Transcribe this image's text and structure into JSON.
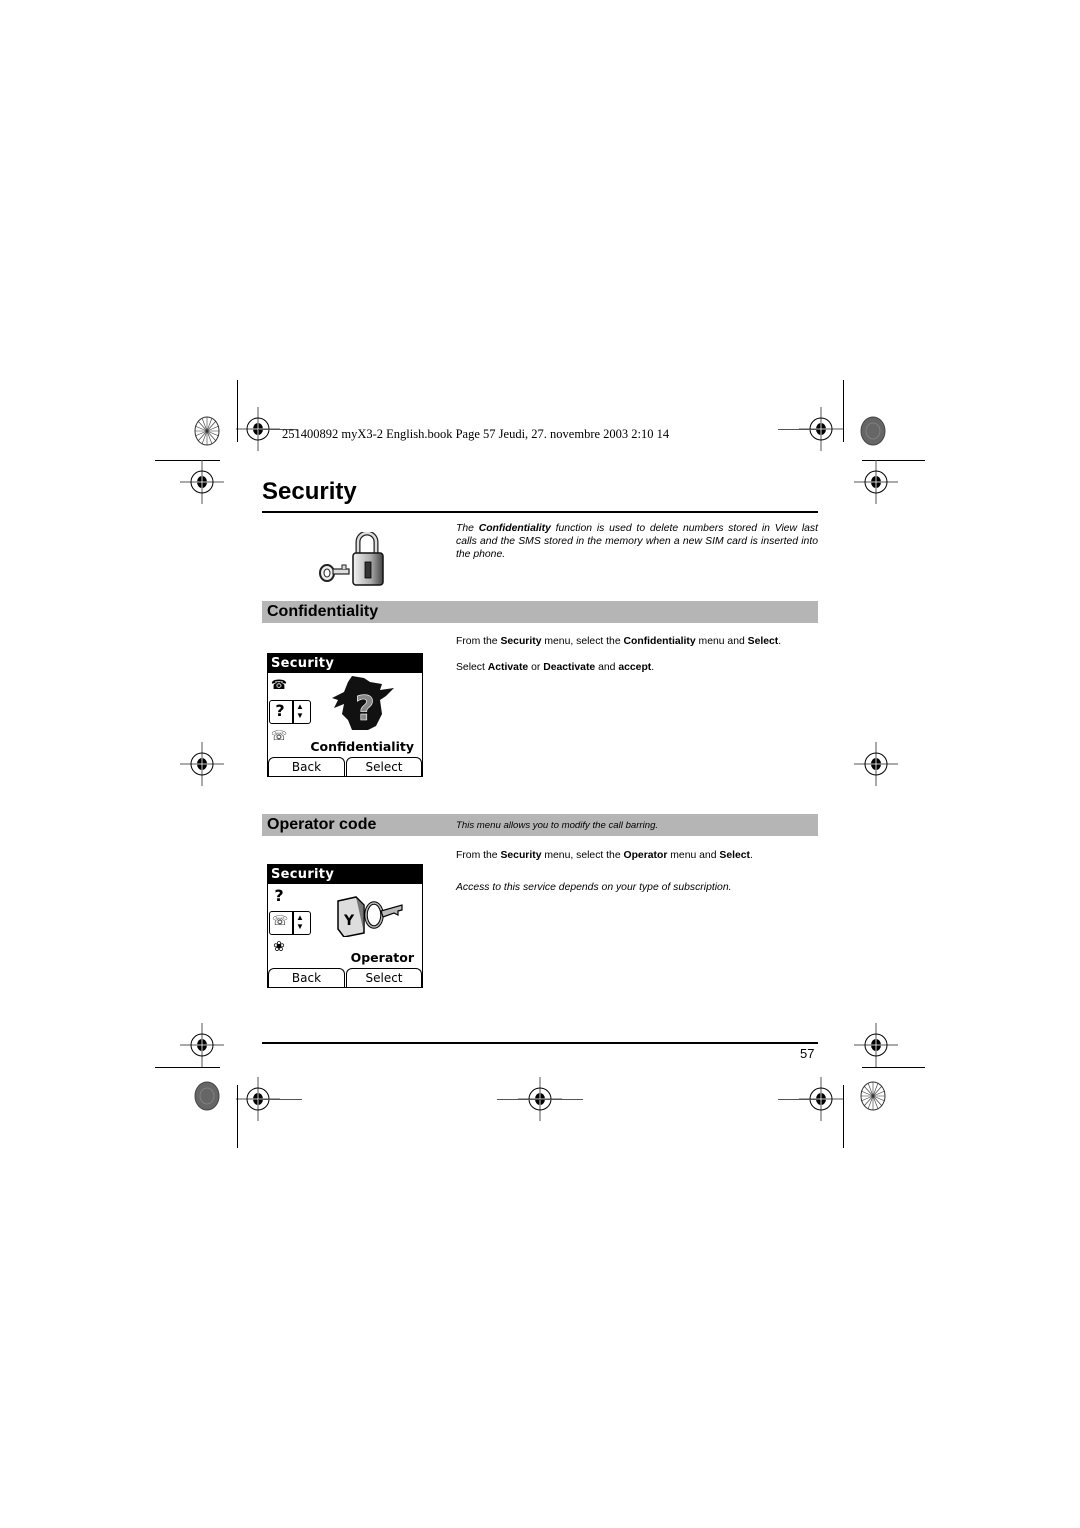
{
  "print_header": {
    "meta_line": "251400892 myX3-2 English.book  Page 57  Jeudi, 27. novembre 2003  2:10 14"
  },
  "page": {
    "title": "Security",
    "number": "57"
  },
  "intro": {
    "prefix": "The ",
    "bold_term": "Confidentiality",
    "suffix": " function is used to delete numbers stored in View last calls and the SMS stored in the memory when a new SIM card is inserted into the phone.",
    "illustration": "key-and-padlock-icon"
  },
  "sections": [
    {
      "title": "Confidentiality",
      "note": "",
      "instructions": [
        {
          "parts": [
            {
              "text": "From the ",
              "bold": false
            },
            {
              "text": "Security",
              "bold": true
            },
            {
              "text": " menu, select the ",
              "bold": false
            },
            {
              "text": "Confidentiality",
              "bold": true
            },
            {
              "text": " menu and ",
              "bold": false
            },
            {
              "text": "Select",
              "bold": true
            },
            {
              "text": ".",
              "bold": false
            }
          ]
        },
        {
          "parts": [
            {
              "text": "Select ",
              "bold": false
            },
            {
              "text": "Activate",
              "bold": true
            },
            {
              "text": " or ",
              "bold": false
            },
            {
              "text": "Deactivate",
              "bold": true
            },
            {
              "text": " and ",
              "bold": false
            },
            {
              "text": "accept",
              "bold": true
            },
            {
              "text": ".",
              "bold": false
            }
          ]
        }
      ],
      "screen": {
        "title": "Security",
        "selected_label": "Confidentiality",
        "softkey_left": "Back",
        "softkey_right": "Select",
        "icons": [
          "phone-book-icon",
          "question-mark-icon",
          "phone-lock-icon"
        ],
        "hero_icon": "question-silhouette-icon"
      }
    },
    {
      "title": "Operator code",
      "note": "This menu allows you to modify the call barring.",
      "instructions": [
        {
          "parts": [
            {
              "text": "From the ",
              "bold": false
            },
            {
              "text": "Security",
              "bold": true
            },
            {
              "text": " menu, select the ",
              "bold": false
            },
            {
              "text": "Operator",
              "bold": true
            },
            {
              "text": " menu and ",
              "bold": false
            },
            {
              "text": "Select",
              "bold": true
            },
            {
              "text": ".",
              "bold": false
            }
          ]
        }
      ],
      "italic_note": "Access to this service depends on your type of subscription.",
      "screen": {
        "title": "Security",
        "selected_label": "Operator",
        "softkey_left": "Back",
        "softkey_right": "Select",
        "icons": [
          "question-mark-icon",
          "phone-lock-icon",
          "puzzle-icon"
        ],
        "hero_icon": "phone-key-icon"
      }
    }
  ],
  "colors": {
    "section_bar": "#b5b5b5",
    "text": "#000000",
    "screen_title_bg": "#000000"
  }
}
